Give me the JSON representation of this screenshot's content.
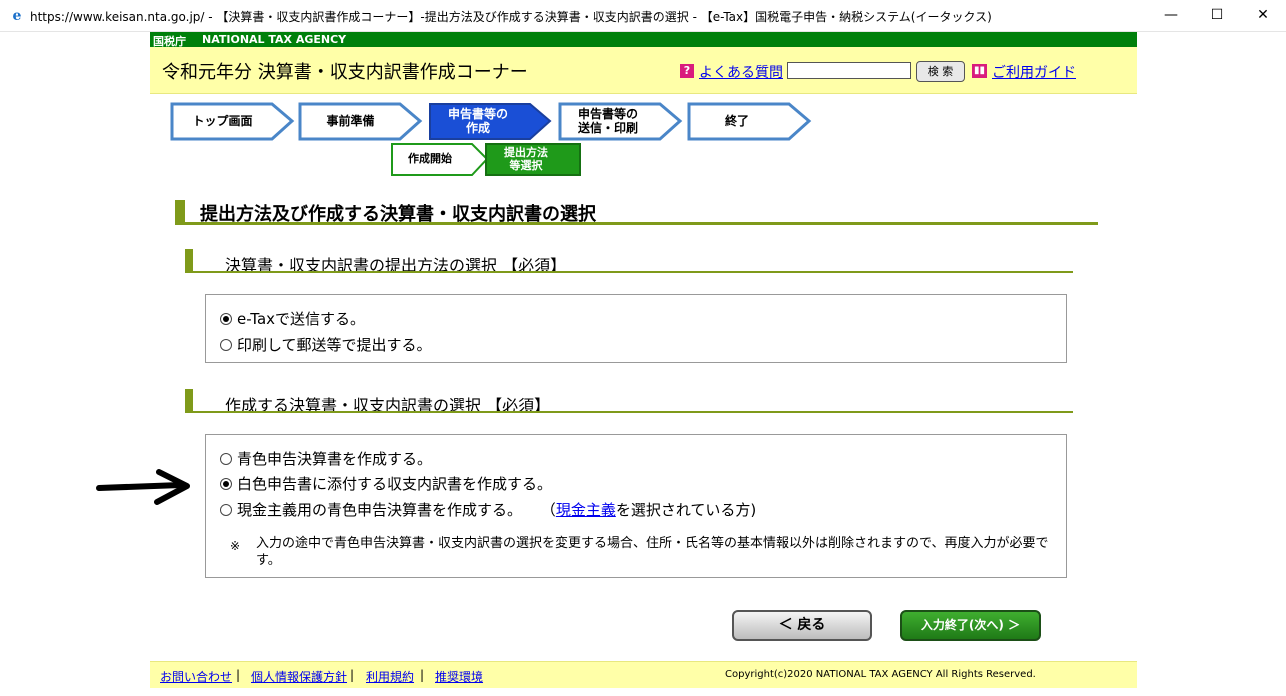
{
  "window": {
    "title": "https://www.keisan.nta.go.jp/ - 【決算書・収支内訳書作成コーナー】-提出方法及び作成する決算書・収支内訳書の選択 - 【e-Tax】国税電子申告・納税システム(イータックス)",
    "minimize": "—",
    "maximize": "☐",
    "close": "✕"
  },
  "agency": {
    "kanji": "国税庁",
    "english": "NATIONAL TAX AGENCY"
  },
  "header": {
    "title": "令和元年分 決算書・収支内訳書作成コーナー",
    "faq_link": "よくある質問",
    "search_value": "",
    "search_button": "検 索",
    "guide_link": "ご利用ガイド"
  },
  "steps": [
    {
      "label": "トップ画面",
      "state": "done"
    },
    {
      "label": "事前準備",
      "state": "done"
    },
    {
      "label": "申告書等の\n作成",
      "state": "current"
    },
    {
      "label": "申告書等の\n送信・印刷",
      "state": "future"
    },
    {
      "label": "終了",
      "state": "future"
    }
  ],
  "substeps": [
    {
      "label": "作成開始",
      "state": "done"
    },
    {
      "label": "提出方法\n等選択",
      "state": "current"
    }
  ],
  "main_heading": "提出方法及び作成する決算書・収支内訳書の選択",
  "section1": {
    "heading": "決算書・収支内訳書の提出方法の選択 【必須】",
    "options": [
      {
        "label": "e-Taxで送信する。",
        "selected": true
      },
      {
        "label": "印刷して郵送等で提出する。",
        "selected": false
      }
    ]
  },
  "section2": {
    "heading": "作成する決算書・収支内訳書の選択 【必須】",
    "options": [
      {
        "label": "青色申告決算書を作成する。",
        "selected": false
      },
      {
        "label": "白色申告書に添付する収支内訳書を作成する。",
        "selected": true
      },
      {
        "label": "現金主義用の青色申告決算書を作成する。",
        "selected": false,
        "suffix_pre": "（",
        "suffix_link": "現金主義",
        "suffix_post": "を選択されている方)"
      }
    ],
    "note_mark": "※",
    "note": "入力の途中で青色申告決算書・収支内訳書の選択を変更する場合、住所・氏名等の基本情報以外は削除されますので、再度入力が必要です。"
  },
  "buttons": {
    "back": "＜ 戻る",
    "next": "入力終了(次へ) ＞"
  },
  "footer": {
    "links": [
      "お問い合わせ",
      "個人情報保護方針",
      "利用規約",
      "推奨環境"
    ],
    "separator": "|",
    "copyright": "Copyright(c)2020 NATIONAL TAX AGENCY All Rights Reserved."
  },
  "colors": {
    "agency_green": "#00800b",
    "header_yellow": "#ffffa8",
    "section_olive": "#7f9a1a",
    "step_current_blue": "#1a4fd6",
    "substep_current_green": "#1f9a1a"
  }
}
